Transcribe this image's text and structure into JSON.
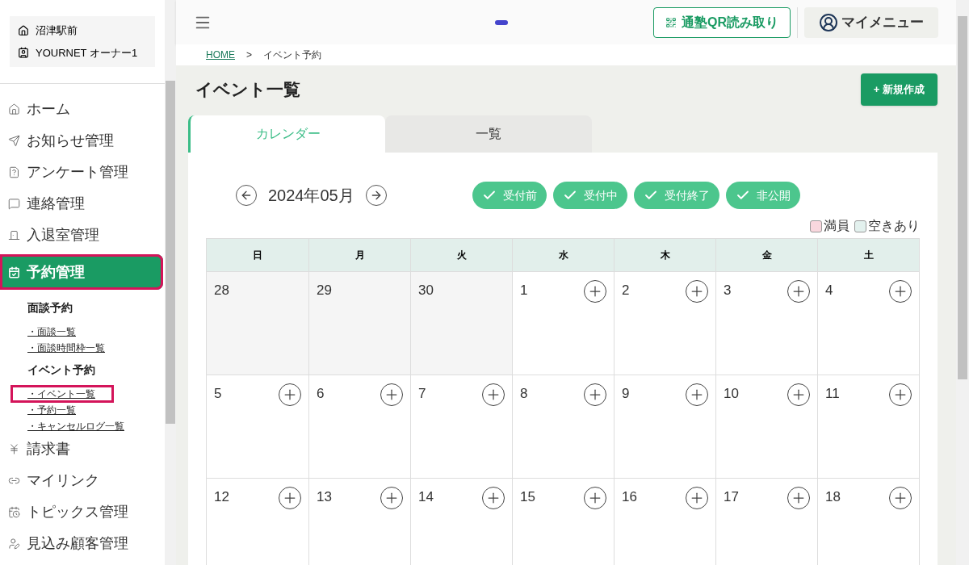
{
  "account": {
    "school": "沼津駅前",
    "user": "YOURNET オーナー1"
  },
  "sidebar": {
    "items": [
      {
        "label": "ホーム",
        "selected": false,
        "highlighted": false
      },
      {
        "label": "お知らせ管理",
        "selected": false,
        "highlighted": false
      },
      {
        "label": "アンケート管理",
        "selected": false,
        "highlighted": false
      },
      {
        "label": "連絡管理",
        "selected": false,
        "highlighted": false
      },
      {
        "label": "入退室管理",
        "selected": false,
        "highlighted": false
      },
      {
        "label": "予約管理",
        "selected": true,
        "highlighted": true,
        "groups": [
          {
            "title": "面談予約",
            "links": [
              {
                "label": "・面談一覧",
                "highlighted": false
              },
              {
                "label": "・面談時間枠一覧",
                "highlighted": false
              }
            ]
          },
          {
            "title": "イベント予約",
            "links": [
              {
                "label": "・イベント一覧",
                "highlighted": true
              },
              {
                "label": "・予約一覧",
                "highlighted": false
              },
              {
                "label": "・キャンセルログ一覧",
                "highlighted": false
              }
            ]
          }
        ]
      },
      {
        "label": "請求書",
        "selected": false,
        "highlighted": false
      },
      {
        "label": "マイリンク",
        "selected": false,
        "highlighted": false
      },
      {
        "label": "トピックス管理",
        "selected": false,
        "highlighted": false
      },
      {
        "label": "見込み顧客管理",
        "selected": false,
        "highlighted": false
      }
    ]
  },
  "header": {
    "qr_button": "通塾QR読み取り",
    "menu_button": "マイメニュー"
  },
  "breadcrumb": [
    "HOME",
    ">",
    "イベント予約"
  ],
  "page": {
    "title": "イベント一覧",
    "new_button": "+ 新規作成"
  },
  "tabs": [
    {
      "label": "カレンダー",
      "selected": true
    },
    {
      "label": "一覧",
      "selected": false
    }
  ],
  "calendar": {
    "month": "2024年05月",
    "filters": [
      {
        "label": "受付前",
        "checked": true
      },
      {
        "label": "受付中",
        "checked": true
      },
      {
        "label": "受付終了",
        "checked": true
      },
      {
        "label": "非公開",
        "checked": true
      }
    ],
    "legend": [
      {
        "label": "満員",
        "color": "#f9d7de"
      },
      {
        "label": "空きあり",
        "color": "#e3f1ee"
      }
    ],
    "weekdays": [
      "日",
      "月",
      "火",
      "水",
      "木",
      "金",
      "土"
    ],
    "weeks": [
      [
        {
          "day": "28",
          "in_month": false
        },
        {
          "day": "29",
          "in_month": false
        },
        {
          "day": "30",
          "in_month": false
        },
        {
          "day": "1",
          "in_month": true
        },
        {
          "day": "2",
          "in_month": true
        },
        {
          "day": "3",
          "in_month": true
        },
        {
          "day": "4",
          "in_month": true
        }
      ],
      [
        {
          "day": "5",
          "in_month": true
        },
        {
          "day": "6",
          "in_month": true
        },
        {
          "day": "7",
          "in_month": true
        },
        {
          "day": "8",
          "in_month": true
        },
        {
          "day": "9",
          "in_month": true
        },
        {
          "day": "10",
          "in_month": true
        },
        {
          "day": "11",
          "in_month": true
        }
      ],
      [
        {
          "day": "12",
          "in_month": true
        },
        {
          "day": "13",
          "in_month": true
        },
        {
          "day": "14",
          "in_month": true
        },
        {
          "day": "15",
          "in_month": true
        },
        {
          "day": "16",
          "in_month": true
        },
        {
          "day": "17",
          "in_month": true
        },
        {
          "day": "18",
          "in_month": true
        }
      ]
    ]
  }
}
